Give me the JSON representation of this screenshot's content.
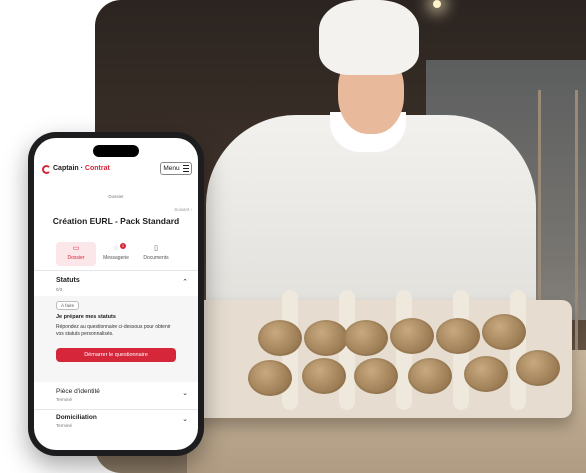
{
  "app": {
    "logo_primary": "Captain",
    "logo_accent": "Contrat",
    "menu_label": "Menu"
  },
  "header": {
    "breadcrumb": "Dossier",
    "next_label": "Suivant",
    "title": "Création EURL - Pack Standard"
  },
  "tabs": [
    {
      "label": "Dossier",
      "icon": "folder-icon",
      "active": true
    },
    {
      "label": "Messagerie",
      "icon": "chat-icon",
      "badge": "1"
    },
    {
      "label": "Documents",
      "icon": "document-icon"
    }
  ],
  "statuts": {
    "title": "Statuts",
    "progress": "0/3",
    "pill": "À faire",
    "step_title": "Je prépare mes statuts",
    "description": "Répondez au questionnaire ci-dessous pour obtenir vos statuts personnalisés.",
    "cta": "Démarrer le questionnaire"
  },
  "sections": [
    {
      "title": "Pièce d'identité",
      "status": "Terminé"
    },
    {
      "title": "Domiciliation",
      "status": "Terminé"
    }
  ],
  "colors": {
    "accent": "#d5263a"
  }
}
